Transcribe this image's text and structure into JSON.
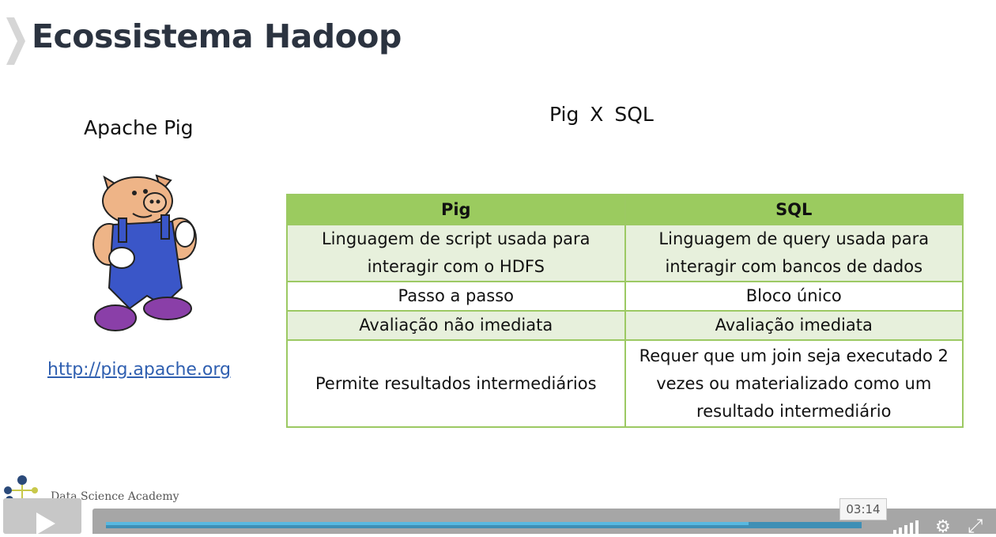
{
  "slide": {
    "title": "Ecossistema Hadoop",
    "left_heading": "Apache Pig",
    "right_heading": "Pig  X  SQL",
    "link": "http://pig.apache.org",
    "mascot_icon": "pig-mascot-icon"
  },
  "table": {
    "headers": [
      "Pig",
      "SQL"
    ],
    "rows": [
      [
        "Linguagem de script usada para interagir com o HDFS",
        "Linguagem de query usada para interagir com bancos de dados"
      ],
      [
        "Passo a passo",
        "Bloco único"
      ],
      [
        "Avaliação não imediata",
        "Avaliação imediata"
      ],
      [
        "Permite resultados intermediários",
        "Requer que um join seja executado 2 vezes ou materializado como um resultado intermediário"
      ]
    ],
    "header_color": "#9bcb5f",
    "shade_color": "#e7f0dc"
  },
  "branding": {
    "logo_text": "Data Science Academy"
  },
  "player": {
    "time": "03:14",
    "progress": 0.85,
    "icons": [
      "play-icon",
      "volume-icon",
      "settings-icon",
      "fullscreen-icon"
    ],
    "accent": "#59b8e0"
  }
}
